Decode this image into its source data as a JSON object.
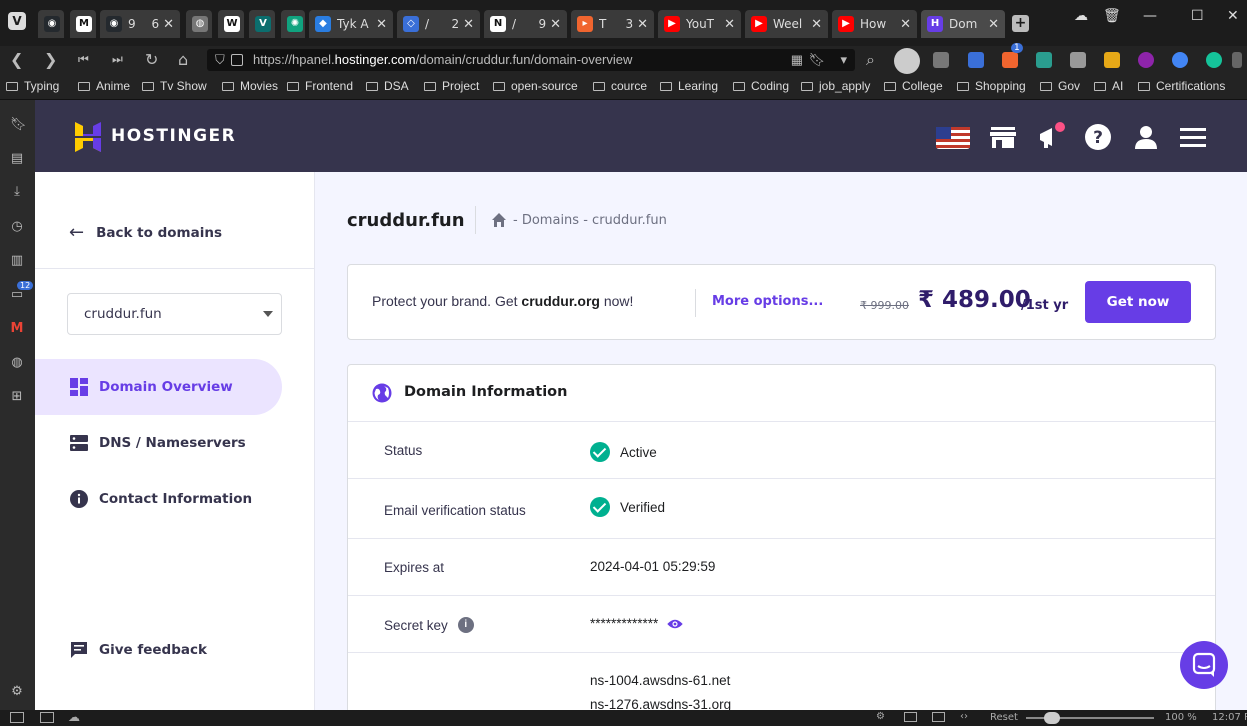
{
  "browser": {
    "tabs": [
      {
        "label": "",
        "num": "",
        "color": "#24292e",
        "glyph": "◉"
      },
      {
        "label": "",
        "num": "",
        "color": "#ffffff",
        "glyph": "M"
      },
      {
        "label": "9",
        "num": "6",
        "color": "#24292e",
        "glyph": "◉"
      },
      {
        "label": "",
        "num": "",
        "color": "#777777",
        "glyph": "◍"
      },
      {
        "label": "",
        "num": "",
        "color": "#ffffff",
        "glyph": "W"
      },
      {
        "label": "",
        "num": "",
        "color": "#0b6e6e",
        "glyph": "V"
      },
      {
        "label": "",
        "num": "",
        "color": "#10a37f",
        "glyph": "✺"
      },
      {
        "label": "Tyk A",
        "num": "",
        "color": "#2a7de1",
        "glyph": "◆"
      },
      {
        "label": "/",
        "num": "2",
        "color": "#3a6fd8",
        "glyph": "◇"
      },
      {
        "label": "/",
        "num": "9",
        "color": "#ffffff",
        "glyph": "N"
      },
      {
        "label": "T",
        "num": "3",
        "color": "#f0652f",
        "glyph": "▸"
      },
      {
        "label": "YouT",
        "num": "",
        "color": "#ff0000",
        "glyph": "▶"
      },
      {
        "label": "Weel",
        "num": "",
        "color": "#ff0000",
        "glyph": "▶"
      },
      {
        "label": "How",
        "num": "",
        "color": "#ff0000",
        "glyph": "▶"
      },
      {
        "label": "Dom",
        "num": "",
        "color": "#673de6",
        "glyph": "H"
      }
    ],
    "url_prefix": "https://hpanel.",
    "url_host": "hostinger.com",
    "url_path": "/domain/cruddur.fun/domain-overview",
    "bookmarks": [
      "Typing",
      "Anime",
      "Tv Show",
      "Movies",
      "Frontend",
      "DSA",
      "Project",
      "open-source",
      "cource",
      "Learing",
      "Coding",
      "job_apply",
      "College",
      "Shopping",
      "Gov",
      "AI",
      "Certifications"
    ],
    "side_badge": "12",
    "ext_badge": "1",
    "status": {
      "reset": "Reset",
      "zoom": "100 %",
      "time": "12:07 P"
    }
  },
  "header": {
    "brand": "HOSTINGER",
    "brand_color": "#673de6",
    "icons": [
      "us-flag-icon",
      "store-icon",
      "announcement-icon",
      "help-icon",
      "account-icon",
      "menu-icon"
    ]
  },
  "sidebar": {
    "back_label": "Back to domains",
    "selected_domain": "cruddur.fun",
    "items": [
      {
        "label": "Domain Overview",
        "icon": "grid-icon",
        "active": true
      },
      {
        "label": "DNS / Nameservers",
        "icon": "server-icon",
        "active": false
      },
      {
        "label": "Contact Information",
        "icon": "info-icon",
        "active": false
      }
    ],
    "feedback_label": "Give feedback"
  },
  "main": {
    "title": "cruddur.fun",
    "breadcrumb": {
      "sep1": "-",
      "domains": "Domains",
      "sep2": "-",
      "current": "cruddur.fun"
    },
    "promo": {
      "prefix": "Protect your brand. Get ",
      "domain": "cruddur.org",
      "suffix": " now!",
      "more": "More options...",
      "old_price": "₹ 999.00",
      "price": "₹ 489.00",
      "period": "/1st yr",
      "button": "Get now"
    },
    "info": {
      "title": "Domain Information",
      "rows": [
        {
          "label": "Status",
          "value": "Active"
        },
        {
          "label": "Email verification status",
          "value": "Verified"
        },
        {
          "label": "Expires at",
          "value": "2024-04-01 05:29:59"
        },
        {
          "label": "Secret key",
          "value": "*************"
        }
      ],
      "nameservers": [
        "ns-1004.awsdns-61.net",
        "ns-1276.awsdns-31.org"
      ]
    }
  }
}
